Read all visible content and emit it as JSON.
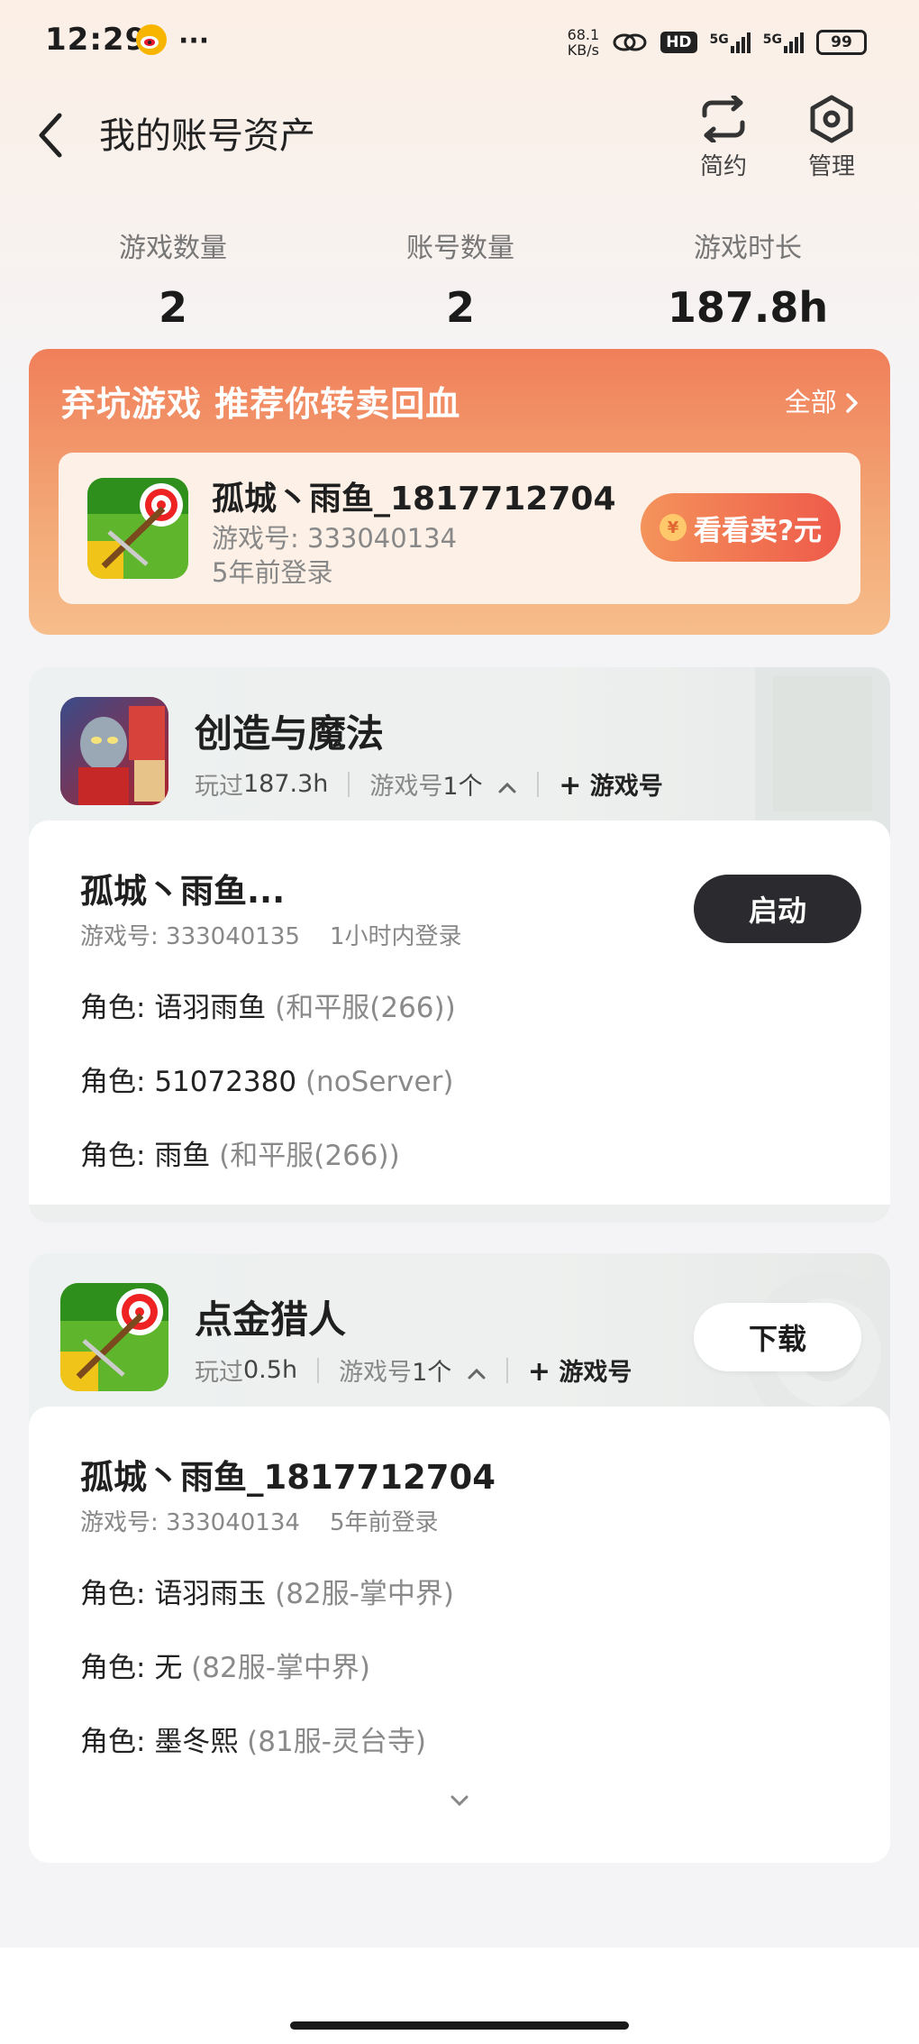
{
  "status_bar": {
    "time": "12:29",
    "net_speed_top": "68.1",
    "net_speed_unit": "KB/s",
    "hd": "HD",
    "net1": "5G",
    "net2": "5G",
    "battery": "99"
  },
  "header": {
    "title": "我的账号资产",
    "simple_label": "简约",
    "manage_label": "管理"
  },
  "stats": [
    {
      "label": "游戏数量",
      "value": "2"
    },
    {
      "label": "账号数量",
      "value": "2"
    },
    {
      "label": "游戏时长",
      "value": "187.8h"
    }
  ],
  "sell": {
    "title": "弃坑游戏 推荐你转卖回血",
    "all_label": "全部",
    "account_name": "孤城丶雨鱼_1817712704",
    "account_id": "游戏号: 333040134",
    "login": "5年前登录",
    "button": "看看卖?元",
    "yen": "¥"
  },
  "games": [
    {
      "name": "创造与魔法",
      "played_label": "玩过",
      "played_value": "187.3h",
      "accounts_label": "游戏号",
      "accounts_value": "1个",
      "add_label": "游戏号",
      "account_name": "孤城丶雨鱼...",
      "account_sub": "游戏号: 333040135    1小时内登录",
      "action": "启动",
      "roles": [
        {
          "label": "角色: ",
          "name": "语羽雨鱼",
          "server": " (和平服(266))"
        },
        {
          "label": "角色: ",
          "name": "51072380",
          "server": " (noServer)"
        },
        {
          "label": "角色: ",
          "name": "雨鱼",
          "server": " (和平服(266))"
        }
      ]
    },
    {
      "name": "点金猎人",
      "played_label": "玩过",
      "played_value": "0.5h",
      "accounts_label": "游戏号",
      "accounts_value": "1个",
      "add_label": "游戏号",
      "account_name": "孤城丶雨鱼_1817712704",
      "account_sub": "游戏号: 333040134    5年前登录",
      "action": "下载",
      "roles": [
        {
          "label": "角色: ",
          "name": "语羽雨玉",
          "server": " (82服-掌中界)"
        },
        {
          "label": "角色: ",
          "name": "无",
          "server": " (82服-掌中界)"
        },
        {
          "label": "角色: ",
          "name": "墨冬熙",
          "server": " (81服-灵台寺)"
        }
      ]
    }
  ]
}
